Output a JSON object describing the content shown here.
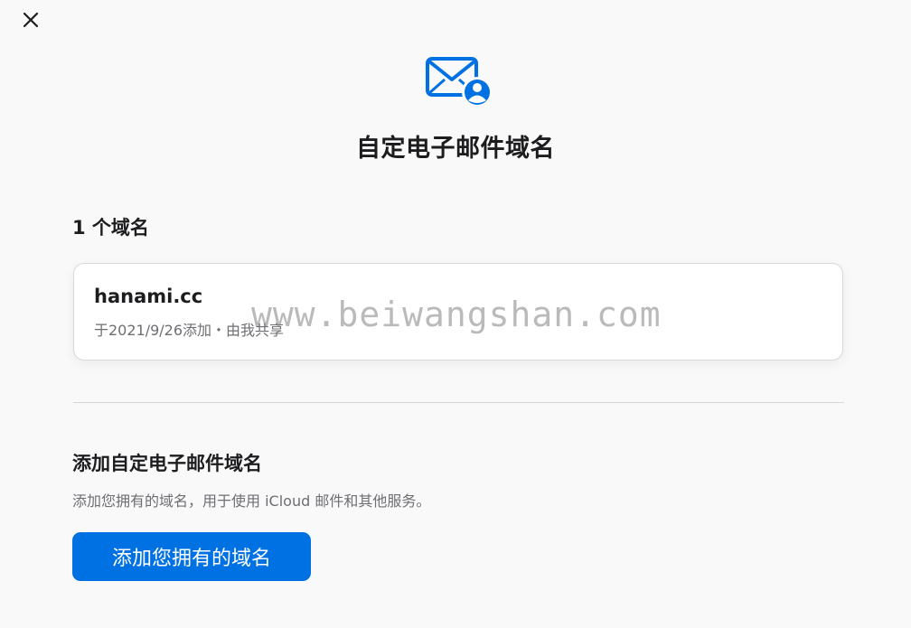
{
  "header": {
    "close_icon": "close-icon",
    "mail_icon": "mail-person-icon",
    "title": "自定电子邮件域名"
  },
  "domains": {
    "count_label": "1 个域名",
    "items": [
      {
        "name": "hanami.cc",
        "meta": "于2021/9/26添加・由我共享"
      }
    ]
  },
  "add_section": {
    "title": "添加自定电子邮件域名",
    "description": "添加您拥有的域名，用于使用 iCloud 邮件和其他服务。",
    "button_label": "添加您拥有的域名"
  },
  "watermark": "www.beiwangshan.com",
  "colors": {
    "accent": "#0071e3",
    "background": "#f9f9fa",
    "text_primary": "#1d1d1f",
    "text_secondary": "#6e6e73"
  }
}
